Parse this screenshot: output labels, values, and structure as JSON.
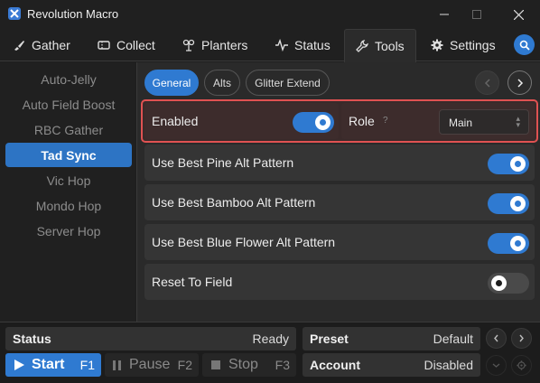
{
  "window": {
    "title": "Revolution Macro"
  },
  "nav": {
    "tabs": [
      {
        "label": "Gather",
        "icon": "brush-icon"
      },
      {
        "label": "Collect",
        "icon": "ticket-icon"
      },
      {
        "label": "Planters",
        "icon": "sprout-icon"
      },
      {
        "label": "Status",
        "icon": "pulse-icon"
      },
      {
        "label": "Tools",
        "icon": "wrench-icon",
        "active": true
      },
      {
        "label": "Settings",
        "icon": "gear-icon"
      }
    ]
  },
  "sidebar": {
    "items": [
      {
        "label": "Auto-Jelly"
      },
      {
        "label": "Auto Field Boost"
      },
      {
        "label": "RBC Gather"
      },
      {
        "label": "Tad Sync",
        "active": true
      },
      {
        "label": "Vic Hop"
      },
      {
        "label": "Mondo Hop"
      },
      {
        "label": "Server Hop"
      }
    ]
  },
  "subtabs": [
    {
      "label": "General",
      "active": true
    },
    {
      "label": "Alts"
    },
    {
      "label": "Glitter Extend"
    }
  ],
  "settings": {
    "enabled": {
      "label": "Enabled",
      "on": true
    },
    "role": {
      "label": "Role",
      "help": "?",
      "value": "Main"
    },
    "rows": [
      {
        "label": "Use Best Pine Alt Pattern",
        "on": true
      },
      {
        "label": "Use Best Bamboo Alt Pattern",
        "on": true
      },
      {
        "label": "Use Best Blue Flower Alt Pattern",
        "on": true
      },
      {
        "label": "Reset To Field",
        "on": false
      }
    ]
  },
  "bottom": {
    "status_label": "Status",
    "status_value": "Ready",
    "preset_label": "Preset",
    "preset_value": "Default",
    "account_label": "Account",
    "account_value": "Disabled",
    "start_label": "Start",
    "start_key": "F1",
    "pause_label": "Pause",
    "pause_key": "F2",
    "stop_label": "Stop",
    "stop_key": "F3"
  },
  "colors": {
    "accent": "#2f7ad1",
    "highlight_border": "#e05252",
    "background": "#1e1e1e"
  }
}
